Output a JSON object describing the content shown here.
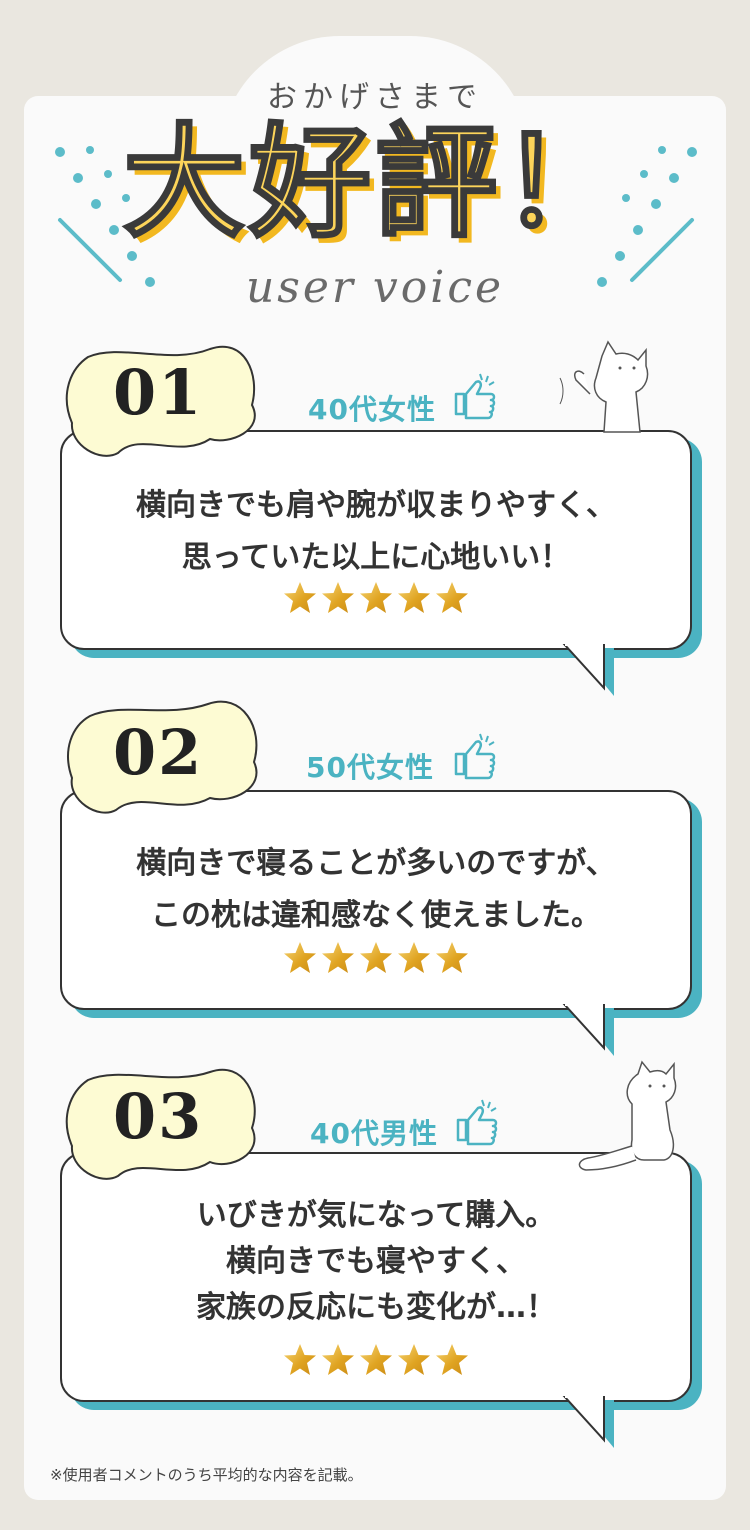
{
  "header": {
    "subtitle": "おかげさまで",
    "title": "大好評！",
    "script": "user voice"
  },
  "colors": {
    "accent": "#4bb3c2",
    "title_yellow": "#fcd45a",
    "badge_fill": "#fdfbd3",
    "star_gold": "#e0a422"
  },
  "reviews": [
    {
      "number": "01",
      "age_label": "40代女性",
      "lines": [
        "横向きでも肩や腕が収まりやすく、",
        "思っていた以上に心地いい！"
      ],
      "rating": 5
    },
    {
      "number": "02",
      "age_label": "50代女性",
      "lines": [
        "横向きで寝ることが多いのですが、",
        "この枕は違和感なく使えました。"
      ],
      "rating": 5
    },
    {
      "number": "03",
      "age_label": "40代男性",
      "lines": [
        "いびきが気になって購入。",
        "横向きでも寝やすく、",
        "家族の反応にも変化が…！"
      ],
      "rating": 5
    }
  ],
  "footnote": "※使用者コメントのうち平均的な内容を記載。"
}
